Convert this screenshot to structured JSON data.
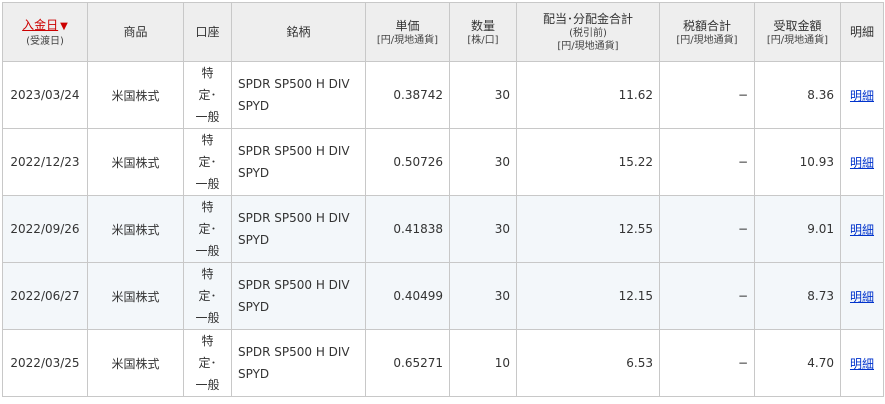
{
  "header": {
    "date_sort_label": "入金日",
    "date_sort_arrow": "▼",
    "date_sub": "(受渡日)",
    "product": "商品",
    "account": "口座",
    "stock": "銘柄",
    "unit_price": "単価",
    "unit_price_unit": "[円/現地通貨]",
    "quantity": "数量",
    "quantity_unit": "[株/口]",
    "dividend_total": "配当･分配金合計",
    "dividend_total_note": "(税引前)",
    "dividend_total_unit": "[円/現地通貨]",
    "tax_total": "税額合計",
    "tax_total_unit": "[円/現地通貨]",
    "received": "受取金額",
    "received_unit": "[円/現地通貨]",
    "detail": "明細"
  },
  "rows": [
    {
      "date": "2023/03/24",
      "product": "米国株式",
      "account": [
        "特",
        "定･",
        "一般"
      ],
      "stock_line1": "SPDR SP500 H DIV",
      "stock_line2": "SPYD",
      "unit_price": "0.38742",
      "quantity": "30",
      "dividend": "11.62",
      "tax": "−",
      "received": "8.36",
      "detail": "明細"
    },
    {
      "date": "2022/12/23",
      "product": "米国株式",
      "account": [
        "特",
        "定･",
        "一般"
      ],
      "stock_line1": "SPDR SP500 H DIV",
      "stock_line2": "SPYD",
      "unit_price": "0.50726",
      "quantity": "30",
      "dividend": "15.22",
      "tax": "−",
      "received": "10.93",
      "detail": "明細"
    },
    {
      "date": "2022/09/26",
      "product": "米国株式",
      "account": [
        "特",
        "定･",
        "一般"
      ],
      "stock_line1": "SPDR SP500 H DIV",
      "stock_line2": "SPYD",
      "unit_price": "0.41838",
      "quantity": "30",
      "dividend": "12.55",
      "tax": "−",
      "received": "9.01",
      "detail": "明細"
    },
    {
      "date": "2022/06/27",
      "product": "米国株式",
      "account": [
        "特",
        "定･",
        "一般"
      ],
      "stock_line1": "SPDR SP500 H DIV",
      "stock_line2": "SPYD",
      "unit_price": "0.40499",
      "quantity": "30",
      "dividend": "12.15",
      "tax": "−",
      "received": "8.73",
      "detail": "明細"
    },
    {
      "date": "2022/03/25",
      "product": "米国株式",
      "account": [
        "特",
        "定･",
        "一般"
      ],
      "stock_line1": "SPDR SP500 H DIV",
      "stock_line2": "SPYD",
      "unit_price": "0.65271",
      "quantity": "10",
      "dividend": "6.53",
      "tax": "−",
      "received": "4.70",
      "detail": "明細"
    }
  ]
}
